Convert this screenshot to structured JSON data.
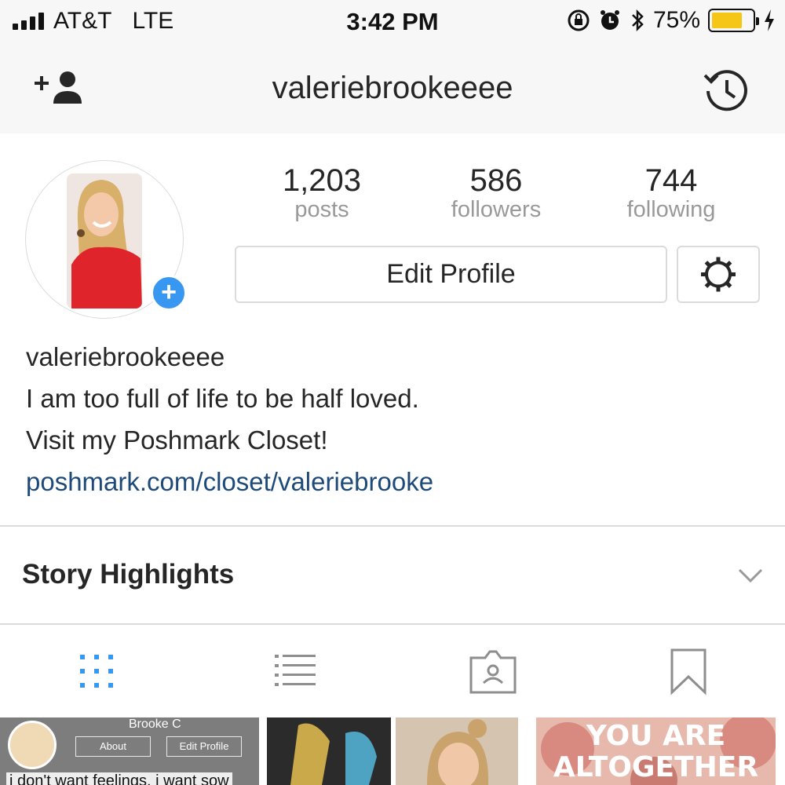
{
  "status_bar": {
    "carrier": "AT&T",
    "network": "LTE",
    "time": "3:42 PM",
    "battery": "75%",
    "battery_level": 0.75
  },
  "nav": {
    "title": "valeriebrookeeee",
    "left_icon": "add-person-icon",
    "right_icon": "history-icon"
  },
  "profile": {
    "stats": [
      {
        "value": "1,203",
        "label": "posts"
      },
      {
        "value": "586",
        "label": "followers"
      },
      {
        "value": "744",
        "label": "following"
      }
    ],
    "edit_label": "Edit Profile",
    "add_story_glyph": "+"
  },
  "bio": {
    "name": "valeriebrookeeee",
    "line1": "I am too full of life to be half loved.",
    "line2": "Visit my Poshmark Closet!",
    "link": "poshmark.com/closet/valeriebrooke"
  },
  "highlights": {
    "label": "Story Highlights"
  },
  "tabs": [
    {
      "icon": "grid-icon",
      "active": true
    },
    {
      "icon": "list-icon",
      "active": false
    },
    {
      "icon": "tagged-icon",
      "active": false
    },
    {
      "icon": "bookmark-icon",
      "active": false
    }
  ],
  "grid": {
    "thumb1": {
      "name": "Brooke C",
      "about": "About",
      "edit": "Edit Profile",
      "caption": "i don't want feelings. i want sow"
    },
    "thumb4": {
      "line1": "YOU ARE",
      "line2": "ALTOGETHER"
    }
  },
  "colors": {
    "accent": "#3897f0",
    "link": "#1e4a7a",
    "battery": "#f5c518"
  }
}
